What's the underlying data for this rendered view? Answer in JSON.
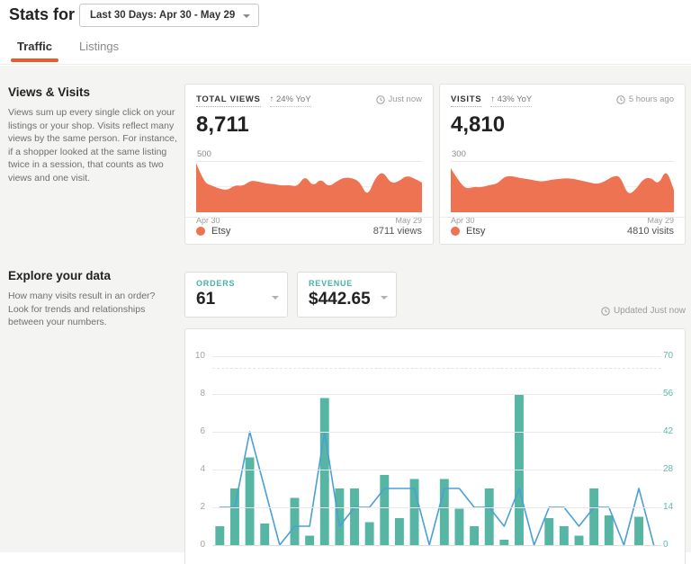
{
  "header": {
    "title": "Stats for",
    "date_selector": "Last 30 Days: Apr 30 - May 29"
  },
  "tabs": [
    {
      "label": "Traffic",
      "active": true
    },
    {
      "label": "Listings",
      "active": false
    }
  ],
  "sections": {
    "views_visits": {
      "heading": "Views & Visits",
      "description": "Views sum up every single click on your listings or your shop. Visits reflect many views by the same person. For instance, if a shopper looked at the same listing twice in a session, that counts as two views and one visit.",
      "cards": [
        {
          "metric_label": "TOTAL VIEWS",
          "yoy": "↑ 24% YoY",
          "updated": "Just now",
          "value": "8,711"
        },
        {
          "metric_label": "VISITS",
          "yoy": "↑ 43% YoY",
          "updated": "5 hours ago",
          "value": "4,810"
        }
      ]
    },
    "explore": {
      "heading": "Explore your data",
      "description": "How many visits result in an order? Look for trends and relationships between your numbers.",
      "selectors": [
        {
          "label": "ORDERS",
          "value": "61"
        },
        {
          "label": "REVENUE",
          "value": "$442.65"
        }
      ],
      "updated": "Updated Just now"
    }
  },
  "colors": {
    "accent_orange": "#e65c2e",
    "area_orange": "#ee7352",
    "bar_teal": "#57b5a4",
    "line_blue": "#4aa0d5",
    "axis_teal": "#5fb9ad"
  },
  "chart_data": [
    {
      "type": "area",
      "name": "Total Views - last 30 days",
      "series_name": "Etsy",
      "total_label": "8711 views",
      "ylim": [
        0,
        500
      ],
      "y_axis_label": "500",
      "x_start": "Apr 30",
      "x_end": "May 29",
      "color": "#ee7352",
      "values": [
        480,
        290,
        260,
        230,
        215,
        265,
        255,
        310,
        300,
        280,
        275,
        260,
        265,
        250,
        360,
        250,
        330,
        245,
        300,
        340,
        335,
        300,
        150,
        340,
        400,
        280,
        300,
        360,
        330,
        290
      ]
    },
    {
      "type": "area",
      "name": "Visits - last 30 days",
      "series_name": "Etsy",
      "total_label": "4810 visits",
      "ylim": [
        0,
        300
      ],
      "y_axis_label": "300",
      "x_start": "Apr 30",
      "x_end": "May 29",
      "color": "#ee7352",
      "values": [
        258,
        185,
        135,
        150,
        145,
        160,
        165,
        210,
        212,
        200,
        195,
        185,
        180,
        190,
        195,
        200,
        195,
        185,
        175,
        165,
        180,
        210,
        215,
        100,
        130,
        195,
        205,
        160,
        255,
        130
      ]
    },
    {
      "type": "combo",
      "name": "Orders vs Revenue - last 30 days (Apr 30 - May 29)",
      "left_axis": {
        "series": "Orders",
        "ticks": [
          0,
          2,
          4,
          6,
          8,
          10
        ],
        "max": 10
      },
      "right_axis": {
        "series": "Revenue",
        "ticks": [
          0,
          14,
          28,
          42,
          56,
          70
        ],
        "max": 70
      },
      "series": [
        {
          "name": "Orders",
          "type": "line",
          "axis": "left",
          "color": "#4aa0d5",
          "values": [
            2,
            2,
            6,
            3,
            0,
            1,
            1,
            6,
            1,
            2,
            2,
            3,
            3,
            3,
            0,
            3,
            3,
            2,
            2,
            1,
            3,
            0,
            2,
            2,
            1,
            2,
            2,
            0,
            3,
            0
          ]
        },
        {
          "name": "Revenue",
          "type": "bar",
          "axis": "right",
          "color": "#57b5a4",
          "values": [
            7,
            21,
            32.5,
            8,
            0,
            17.5,
            3.5,
            54.5,
            21,
            21,
            8.5,
            26,
            10,
            24.5,
            0,
            24.5,
            13.5,
            7,
            21,
            2,
            56,
            0,
            10,
            7,
            3.5,
            21,
            11,
            0,
            10.5,
            0
          ]
        }
      ]
    }
  ]
}
